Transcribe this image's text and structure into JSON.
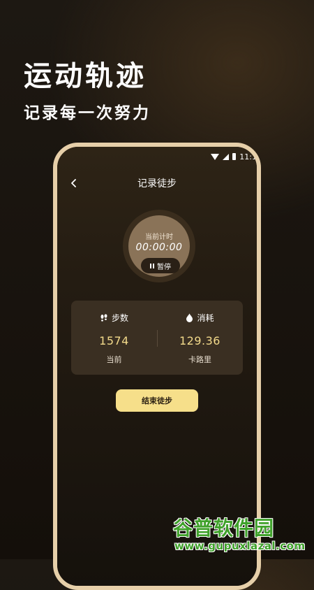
{
  "promo": {
    "title": "运动轨迹",
    "subtitle": "记录每一次努力"
  },
  "statusbar": {
    "time": "11:1",
    "icons": [
      "wifi-icon",
      "signal-icon",
      "battery-icon"
    ]
  },
  "header": {
    "title": "记录徒步",
    "back_icon": "chevron-left-icon"
  },
  "timer": {
    "label": "当前计时",
    "value": "00:00:00",
    "pause_label": "暂停",
    "pause_icon": "pause-icon"
  },
  "stats": {
    "steps": {
      "label": "步数",
      "icon": "footprints-icon",
      "value": "1574",
      "unit": "当前"
    },
    "calories": {
      "label": "消耗",
      "icon": "flame-drop-icon",
      "value": "129.36",
      "unit": "卡路里"
    }
  },
  "actions": {
    "end_label": "结束徒步"
  },
  "watermark": {
    "brand": "谷普软件园",
    "url": "www.gupuxlazal.com"
  },
  "colors": {
    "accent": "#f6df8a",
    "value_text": "#f3da8b",
    "phone_frame": "#e6cfa9",
    "card_bg": "#3a2f22",
    "watermark": "#3fa12a"
  }
}
